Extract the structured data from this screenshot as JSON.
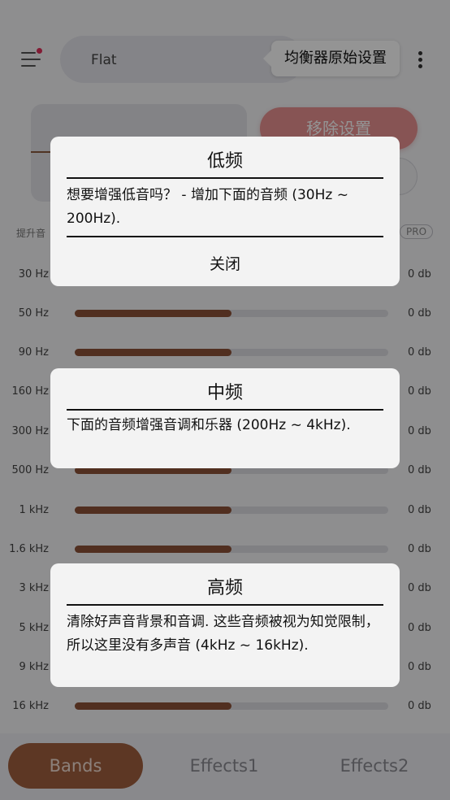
{
  "header": {
    "preset_name": "Flat",
    "tooltip": "均衡器原始设置"
  },
  "controls": {
    "remove_settings": "移除设置",
    "boost_label": "提升音",
    "pro_badge": "PRO"
  },
  "bands": [
    {
      "label": "30 Hz",
      "value": "0 db",
      "level": 0.5
    },
    {
      "label": "50 Hz",
      "value": "0 db",
      "level": 0.5
    },
    {
      "label": "90 Hz",
      "value": "0 db",
      "level": 0.5
    },
    {
      "label": "160 Hz",
      "value": "0 db",
      "level": 0.5
    },
    {
      "label": "300 Hz",
      "value": "0 db",
      "level": 0.5
    },
    {
      "label": "500 Hz",
      "value": "0 db",
      "level": 0.5
    },
    {
      "label": "1 kHz",
      "value": "0 db",
      "level": 0.5
    },
    {
      "label": "1.6 kHz",
      "value": "0 db",
      "level": 0.5
    },
    {
      "label": "3 kHz",
      "value": "0 db",
      "level": 0.5
    },
    {
      "label": "5 kHz",
      "value": "0 db",
      "level": 0.5
    },
    {
      "label": "9 kHz",
      "value": "0 db",
      "level": 0.5
    },
    {
      "label": "16 kHz",
      "value": "0 db",
      "level": 0.5
    }
  ],
  "bottom_nav": {
    "tabs": [
      "Bands",
      "Effects1",
      "Effects2"
    ],
    "active": "Bands"
  },
  "cards": {
    "low": {
      "title": "低频",
      "body": "想要增强低音吗？ - 增加下面的音频 (30Hz ~ 200Hz).",
      "close": "关闭"
    },
    "mid": {
      "title": "中频",
      "body": "下面的音频增强音调和乐器 (200Hz ~ 4kHz)."
    },
    "high": {
      "title": "高频",
      "body": "清除好声音背景和音调. 这些音频被视为知觉限制，所以这里没有多声音 (4kHz ~ 16kHz)."
    }
  },
  "colors": {
    "accent": "#a0603f",
    "slider_fill": "#8c5238",
    "remove_button": "#e89191",
    "notification_dot": "#e0305a"
  }
}
